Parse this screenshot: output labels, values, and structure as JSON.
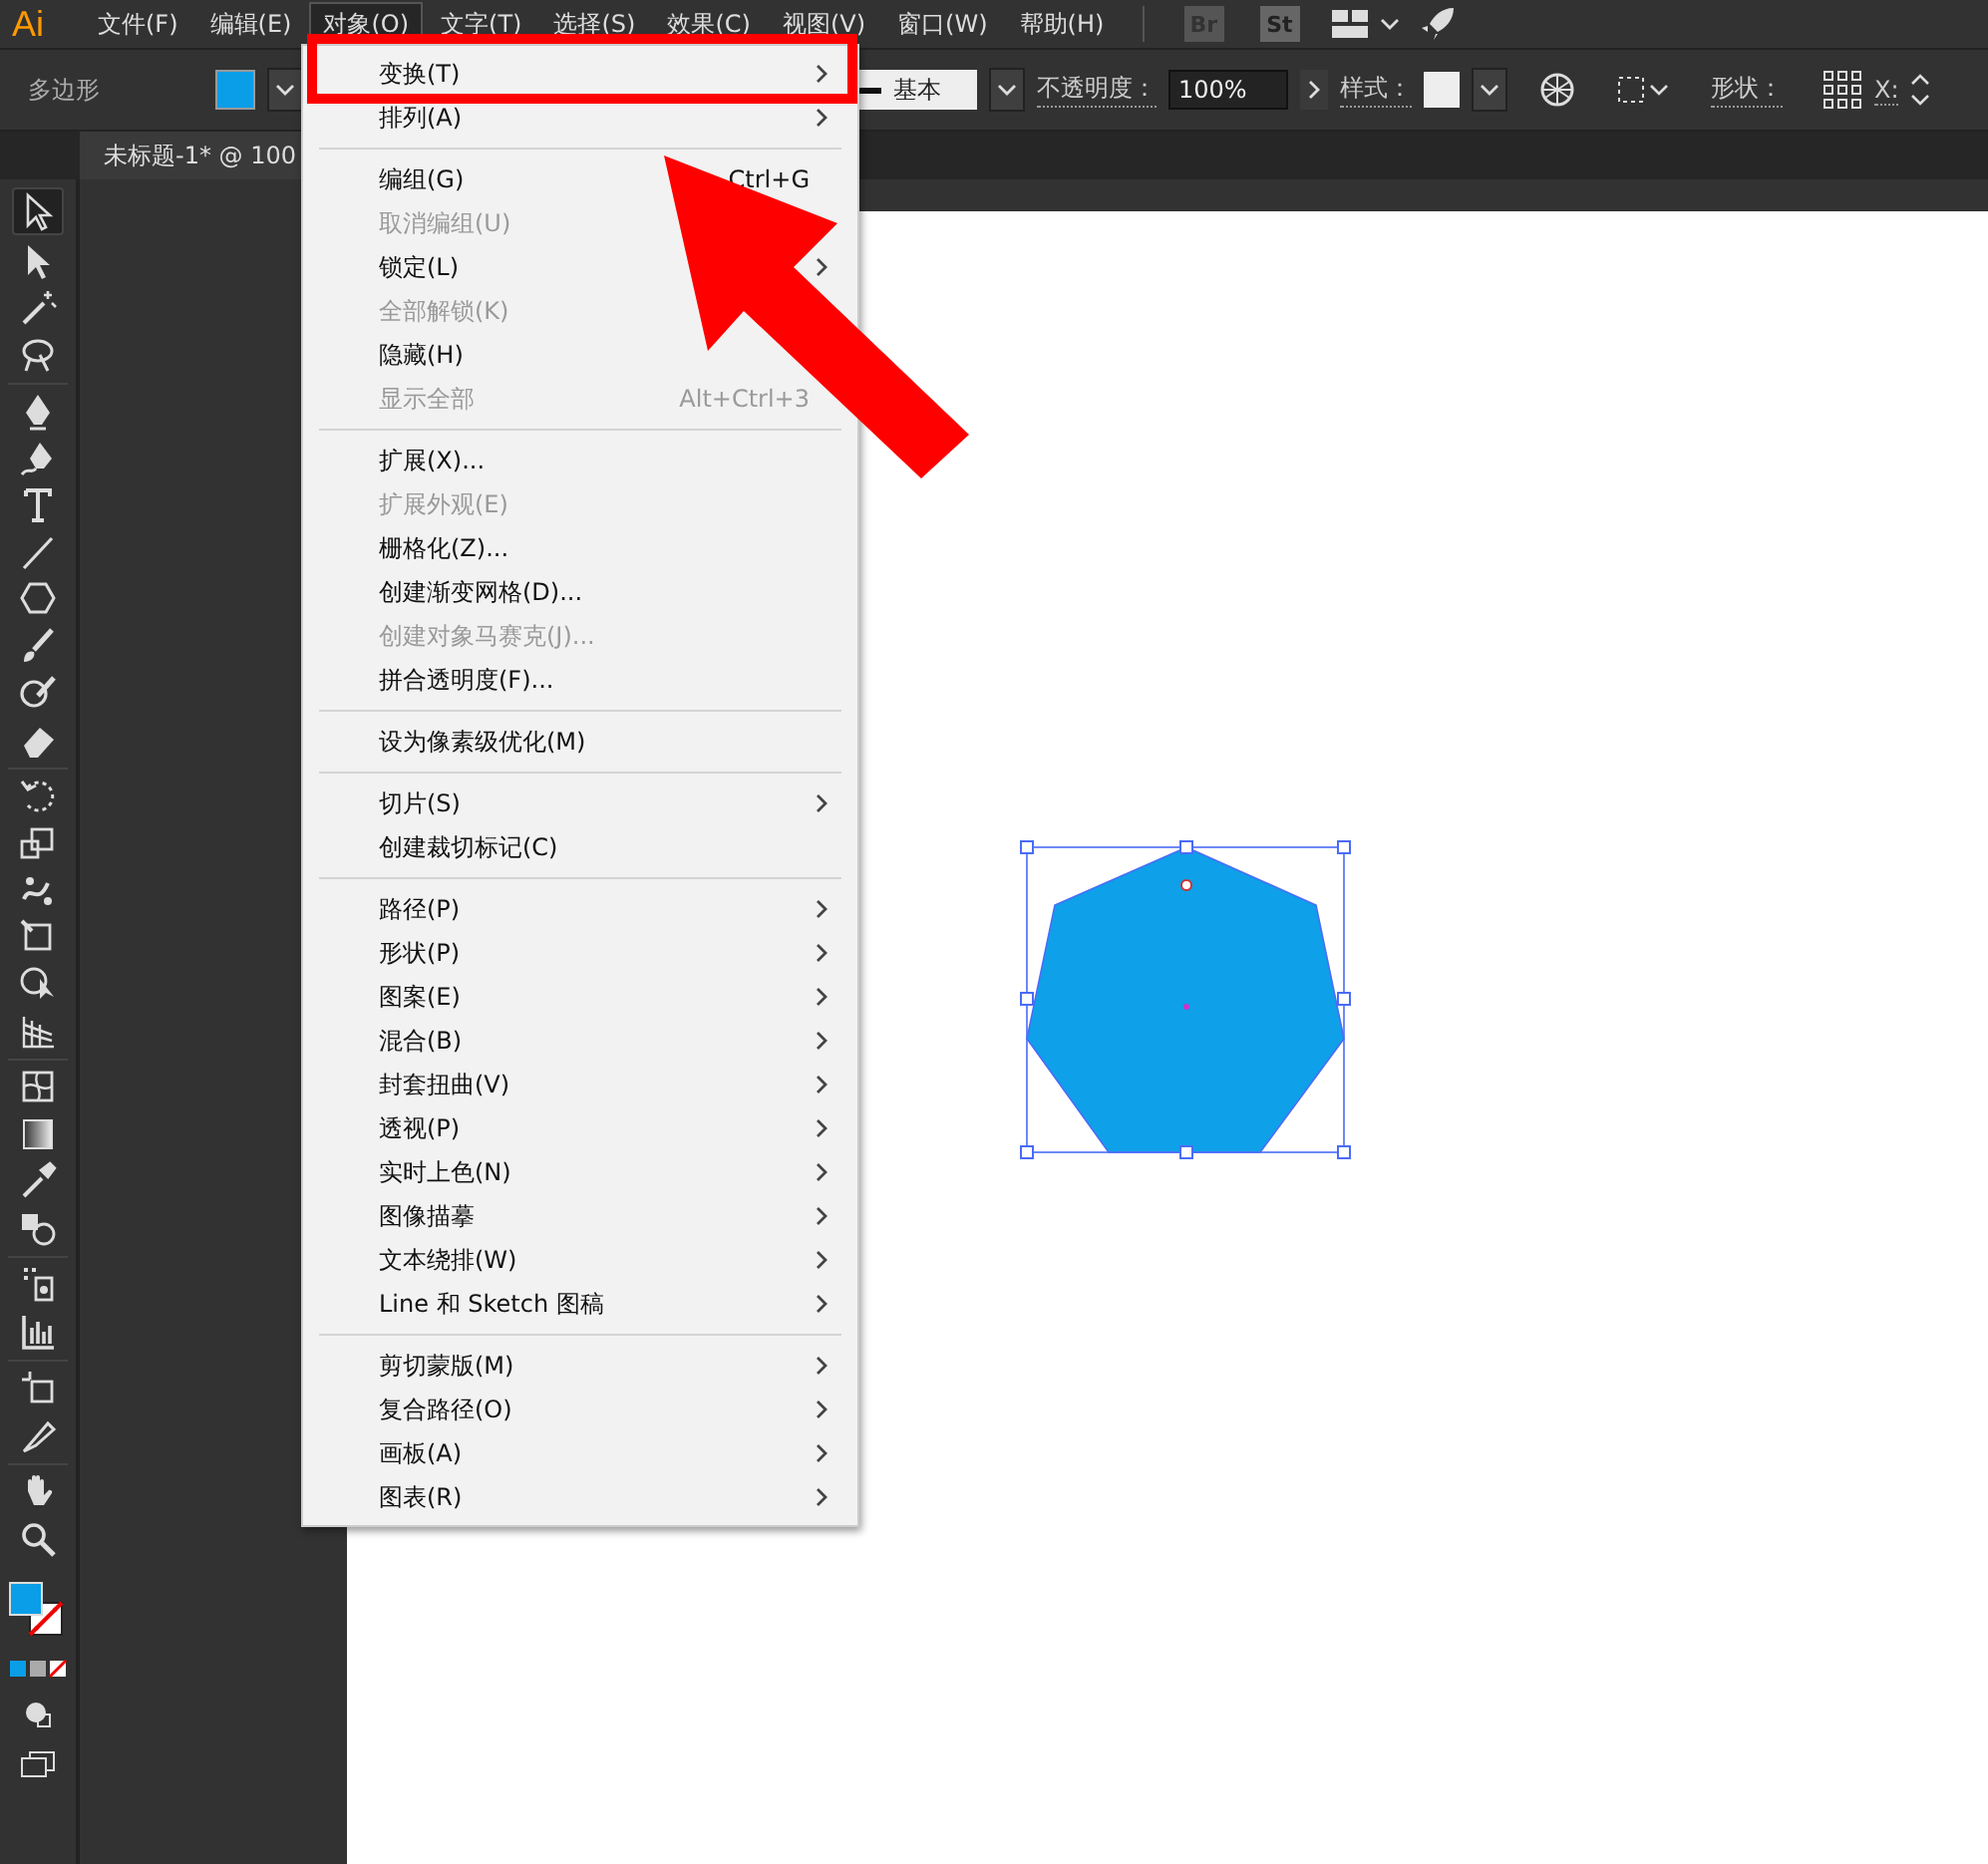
{
  "app_logo": "Ai",
  "menubar": [
    {
      "label": "文件(F)",
      "selected": false
    },
    {
      "label": "编辑(E)",
      "selected": false
    },
    {
      "label": "对象(O)",
      "selected": true
    },
    {
      "label": "文字(T)",
      "selected": false
    },
    {
      "label": "选择(S)",
      "selected": false
    },
    {
      "label": "效果(C)",
      "selected": false
    },
    {
      "label": "视图(V)",
      "selected": false
    },
    {
      "label": "窗口(W)",
      "selected": false
    },
    {
      "label": "帮助(H)",
      "selected": false
    }
  ],
  "app_buttons": [
    "Br",
    "St"
  ],
  "control_bar": {
    "tool_label": "多边形",
    "stroke_profile": "基本",
    "opacity_label": "不透明度：",
    "opacity_value": "100%",
    "style_label": "样式：",
    "shape_label": "形状：",
    "x_label": "X:"
  },
  "document_tab": {
    "title": "未标题-1* @ 100"
  },
  "tools": [
    {
      "kind": "selection",
      "selected": true
    },
    {
      "kind": "direct",
      "selected": false
    },
    {
      "kind": "wand",
      "selected": false
    },
    {
      "kind": "lasso",
      "selected": false
    },
    {
      "kind": "pen",
      "selected": false
    },
    {
      "kind": "curvature",
      "selected": false
    },
    {
      "kind": "type",
      "selected": false
    },
    {
      "kind": "line",
      "selected": false
    },
    {
      "kind": "polygon",
      "selected": false
    },
    {
      "kind": "brush",
      "selected": false
    },
    {
      "kind": "shaper",
      "selected": false
    },
    {
      "kind": "eraser",
      "selected": false
    },
    {
      "kind": "rotate",
      "selected": false
    },
    {
      "kind": "scale",
      "selected": false
    },
    {
      "kind": "warp",
      "selected": false
    },
    {
      "kind": "freetransform",
      "selected": false
    },
    {
      "kind": "shapebuilder",
      "selected": false
    },
    {
      "kind": "perspective",
      "selected": false
    },
    {
      "kind": "mesh",
      "selected": false
    },
    {
      "kind": "gradient",
      "selected": false
    },
    {
      "kind": "eyedropper",
      "selected": false
    },
    {
      "kind": "blend",
      "selected": false
    },
    {
      "kind": "symbol",
      "selected": false
    },
    {
      "kind": "graph",
      "selected": false
    },
    {
      "kind": "artboard",
      "selected": false
    },
    {
      "kind": "slice",
      "selected": false
    },
    {
      "kind": "hand",
      "selected": false
    },
    {
      "kind": "zoom",
      "selected": false
    }
  ],
  "object_menu": {
    "items": [
      {
        "kind": "item",
        "label": "变换(T)",
        "disabled": false,
        "submenu": true
      },
      {
        "kind": "item",
        "label": "排列(A)",
        "disabled": false,
        "submenu": true
      },
      {
        "kind": "separator"
      },
      {
        "kind": "item",
        "label": "编组(G)",
        "disabled": false,
        "shortcut": "Ctrl+G",
        "submenu": false
      },
      {
        "kind": "item",
        "label": "取消编组(U)",
        "disabled": true,
        "submenu": false
      },
      {
        "kind": "item",
        "label": "锁定(L)",
        "disabled": false,
        "submenu": true
      },
      {
        "kind": "item",
        "label": "全部解锁(K)",
        "disabled": true,
        "submenu": false
      },
      {
        "kind": "item",
        "label": "隐藏(H)",
        "disabled": false,
        "submenu": false
      },
      {
        "kind": "item",
        "label": "显示全部",
        "disabled": true,
        "shortcut": "Alt+Ctrl+3",
        "submenu": false
      },
      {
        "kind": "separator"
      },
      {
        "kind": "item",
        "label": "扩展(X)...",
        "disabled": false,
        "submenu": false
      },
      {
        "kind": "item",
        "label": "扩展外观(E)",
        "disabled": true,
        "submenu": false
      },
      {
        "kind": "item",
        "label": "栅格化(Z)...",
        "disabled": false,
        "submenu": false
      },
      {
        "kind": "item",
        "label": "创建渐变网格(D)...",
        "disabled": false,
        "submenu": false
      },
      {
        "kind": "item",
        "label": "创建对象马赛克(J)...",
        "disabled": true,
        "submenu": false
      },
      {
        "kind": "item",
        "label": "拼合透明度(F)...",
        "disabled": false,
        "submenu": false
      },
      {
        "kind": "separator"
      },
      {
        "kind": "item",
        "label": "设为像素级优化(M)",
        "disabled": false,
        "submenu": false
      },
      {
        "kind": "separator"
      },
      {
        "kind": "item",
        "label": "切片(S)",
        "disabled": false,
        "submenu": true
      },
      {
        "kind": "item",
        "label": "创建裁切标记(C)",
        "disabled": false,
        "submenu": false
      },
      {
        "kind": "separator"
      },
      {
        "kind": "item",
        "label": "路径(P)",
        "disabled": false,
        "submenu": true
      },
      {
        "kind": "item",
        "label": "形状(P)",
        "disabled": false,
        "submenu": true
      },
      {
        "kind": "item",
        "label": "图案(E)",
        "disabled": false,
        "submenu": true
      },
      {
        "kind": "item",
        "label": "混合(B)",
        "disabled": false,
        "submenu": true
      },
      {
        "kind": "item",
        "label": "封套扭曲(V)",
        "disabled": false,
        "submenu": true
      },
      {
        "kind": "item",
        "label": "透视(P)",
        "disabled": false,
        "submenu": true
      },
      {
        "kind": "item",
        "label": "实时上色(N)",
        "disabled": false,
        "submenu": true
      },
      {
        "kind": "item",
        "label": "图像描摹",
        "disabled": false,
        "submenu": true
      },
      {
        "kind": "item",
        "label": "文本绕排(W)",
        "disabled": false,
        "submenu": true
      },
      {
        "kind": "item",
        "label": "Line 和 Sketch 图稿",
        "disabled": false,
        "submenu": true
      },
      {
        "kind": "separator"
      },
      {
        "kind": "item",
        "label": "剪切蒙版(M)",
        "disabled": false,
        "submenu": true
      },
      {
        "kind": "item",
        "label": "复合路径(O)",
        "disabled": false,
        "submenu": true
      },
      {
        "kind": "item",
        "label": "画板(A)",
        "disabled": false,
        "submenu": true
      },
      {
        "kind": "item",
        "label": "图表(R)",
        "disabled": false,
        "submenu": true
      }
    ]
  },
  "artwork": {
    "color": "#0ea0e8",
    "selected": true
  }
}
